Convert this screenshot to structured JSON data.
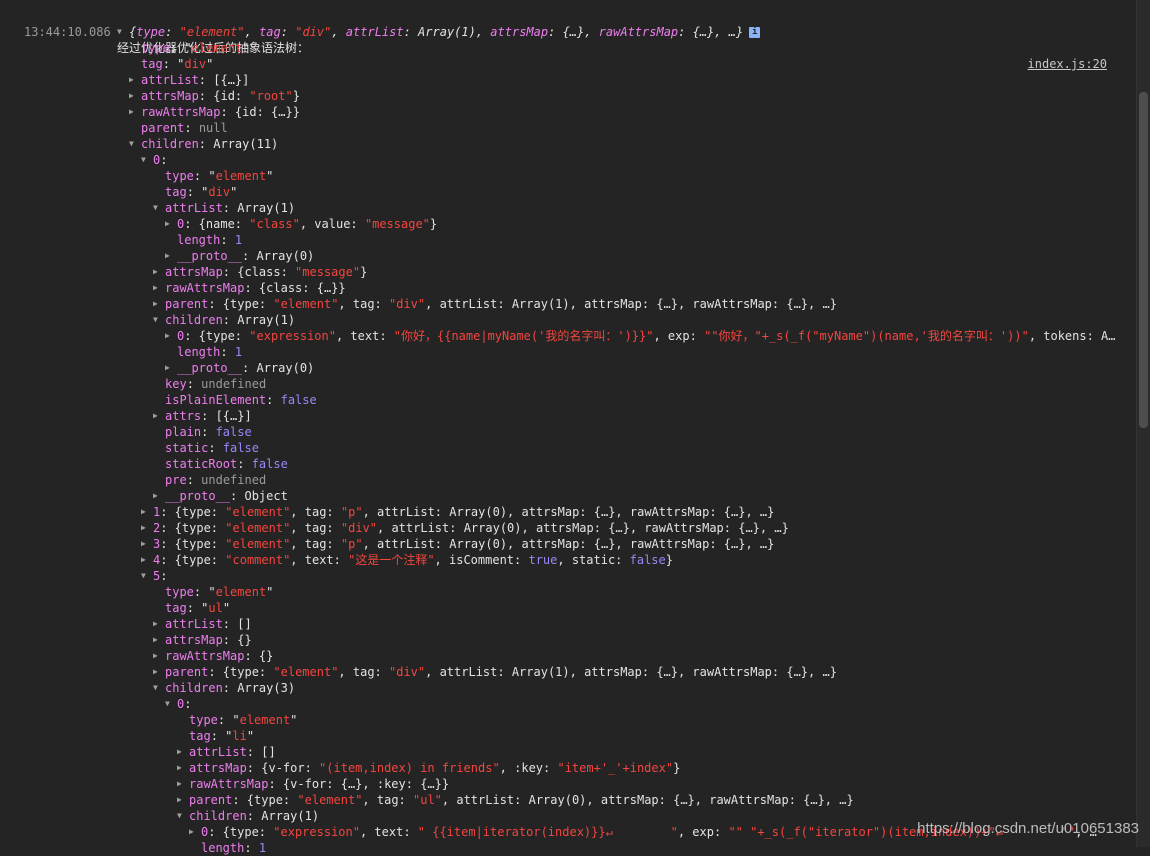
{
  "console": {
    "timestamp": "13:44:10.086",
    "message": "经过优化器优化过后的抽象语法树：",
    "source_link": "index.js:20",
    "info_badge": "i",
    "lines": [
      {
        "indent": 0,
        "tri": "down",
        "tokens": [
          [
            "p",
            "{"
          ],
          [
            "k",
            "type"
          ],
          [
            "p",
            ": "
          ],
          [
            "s",
            "\"element\""
          ],
          [
            "p",
            ", "
          ],
          [
            "k",
            "tag"
          ],
          [
            "p",
            ": "
          ],
          [
            "s",
            "\"div\""
          ],
          [
            "p",
            ", "
          ],
          [
            "k",
            "attrList"
          ],
          [
            "p",
            ": Array(1), "
          ],
          [
            "k",
            "attrsMap"
          ],
          [
            "p",
            ": {…}, "
          ],
          [
            "k",
            "rawAttrsMap"
          ],
          [
            "p",
            ": {…}, …}"
          ]
        ]
      },
      {
        "indent": 1,
        "tri": "",
        "tokens": [
          [
            "k",
            "type"
          ],
          [
            "p",
            ": \""
          ],
          [
            "s",
            "element"
          ],
          [
            "p",
            "\""
          ]
        ]
      },
      {
        "indent": 1,
        "tri": "",
        "tokens": [
          [
            "k",
            "tag"
          ],
          [
            "p",
            ": \""
          ],
          [
            "s",
            "div"
          ],
          [
            "p",
            "\""
          ]
        ]
      },
      {
        "indent": 1,
        "tri": "right",
        "tokens": [
          [
            "k",
            "attrList"
          ],
          [
            "p",
            ": [{…}]"
          ]
        ]
      },
      {
        "indent": 1,
        "tri": "right",
        "tokens": [
          [
            "k",
            "attrsMap"
          ],
          [
            "p",
            ": {id: "
          ],
          [
            "s",
            "\"root\""
          ],
          [
            "p",
            "}"
          ]
        ]
      },
      {
        "indent": 1,
        "tri": "right",
        "tokens": [
          [
            "k",
            "rawAttrsMap"
          ],
          [
            "p",
            ": {id: {…}}"
          ]
        ]
      },
      {
        "indent": 1,
        "tri": "",
        "tokens": [
          [
            "k",
            "parent"
          ],
          [
            "p",
            ": "
          ],
          [
            "g",
            "null"
          ]
        ]
      },
      {
        "indent": 1,
        "tri": "down",
        "tokens": [
          [
            "k",
            "children"
          ],
          [
            "p",
            ": Array(11)"
          ]
        ]
      },
      {
        "indent": 2,
        "tri": "down",
        "tokens": [
          [
            "k",
            "0"
          ],
          [
            "p",
            ":"
          ]
        ]
      },
      {
        "indent": 3,
        "tri": "",
        "tokens": [
          [
            "k",
            "type"
          ],
          [
            "p",
            ": \""
          ],
          [
            "s",
            "element"
          ],
          [
            "p",
            "\""
          ]
        ]
      },
      {
        "indent": 3,
        "tri": "",
        "tokens": [
          [
            "k",
            "tag"
          ],
          [
            "p",
            ": \""
          ],
          [
            "s",
            "div"
          ],
          [
            "p",
            "\""
          ]
        ]
      },
      {
        "indent": 3,
        "tri": "down",
        "tokens": [
          [
            "k",
            "attrList"
          ],
          [
            "p",
            ": Array(1)"
          ]
        ]
      },
      {
        "indent": 4,
        "tri": "right",
        "tokens": [
          [
            "k",
            "0"
          ],
          [
            "p",
            ": {name: "
          ],
          [
            "s",
            "\"class\""
          ],
          [
            "p",
            ", value: "
          ],
          [
            "s",
            "\"message\""
          ],
          [
            "p",
            "}"
          ]
        ]
      },
      {
        "indent": 4,
        "tri": "",
        "tokens": [
          [
            "k",
            "length"
          ],
          [
            "p",
            ": "
          ],
          [
            "n",
            "1"
          ]
        ]
      },
      {
        "indent": 4,
        "tri": "right",
        "tokens": [
          [
            "k",
            "__proto__"
          ],
          [
            "p",
            ": Array(0)"
          ]
        ]
      },
      {
        "indent": 3,
        "tri": "right",
        "tokens": [
          [
            "k",
            "attrsMap"
          ],
          [
            "p",
            ": {class: "
          ],
          [
            "s",
            "\"message\""
          ],
          [
            "p",
            "}"
          ]
        ]
      },
      {
        "indent": 3,
        "tri": "right",
        "tokens": [
          [
            "k",
            "rawAttrsMap"
          ],
          [
            "p",
            ": {class: {…}}"
          ]
        ]
      },
      {
        "indent": 3,
        "tri": "right",
        "tokens": [
          [
            "k",
            "parent"
          ],
          [
            "p",
            ": {type: "
          ],
          [
            "s",
            "\"element\""
          ],
          [
            "p",
            ", tag: "
          ],
          [
            "s",
            "\"div\""
          ],
          [
            "p",
            ", attrList: Array(1), attrsMap: {…}, rawAttrsMap: {…}, …}"
          ]
        ]
      },
      {
        "indent": 3,
        "tri": "down",
        "tokens": [
          [
            "k",
            "children"
          ],
          [
            "p",
            ": Array(1)"
          ]
        ]
      },
      {
        "indent": 4,
        "tri": "right",
        "tokens": [
          [
            "k",
            "0"
          ],
          [
            "p",
            ": {type: "
          ],
          [
            "s",
            "\"expression\""
          ],
          [
            "p",
            ", text: "
          ],
          [
            "s",
            "\"你好，{{name|myName('我的名字叫：')}}\""
          ],
          [
            "p",
            ", exp: "
          ],
          [
            "s",
            "\"\"你好，\"+_s(_f(\"myName\")(name,'我的名字叫：'))\""
          ],
          [
            "p",
            ", tokens: A…"
          ]
        ]
      },
      {
        "indent": 4,
        "tri": "",
        "tokens": [
          [
            "k",
            "length"
          ],
          [
            "p",
            ": "
          ],
          [
            "n",
            "1"
          ]
        ]
      },
      {
        "indent": 4,
        "tri": "right",
        "tokens": [
          [
            "k",
            "__proto__"
          ],
          [
            "p",
            ": Array(0)"
          ]
        ]
      },
      {
        "indent": 3,
        "tri": "",
        "tokens": [
          [
            "k",
            "key"
          ],
          [
            "p",
            ": "
          ],
          [
            "g",
            "undefined"
          ]
        ]
      },
      {
        "indent": 3,
        "tri": "",
        "tokens": [
          [
            "k",
            "isPlainElement"
          ],
          [
            "p",
            ": "
          ],
          [
            "n",
            "false"
          ]
        ]
      },
      {
        "indent": 3,
        "tri": "right",
        "tokens": [
          [
            "k",
            "attrs"
          ],
          [
            "p",
            ": [{…}]"
          ]
        ]
      },
      {
        "indent": 3,
        "tri": "",
        "tokens": [
          [
            "k",
            "plain"
          ],
          [
            "p",
            ": "
          ],
          [
            "n",
            "false"
          ]
        ]
      },
      {
        "indent": 3,
        "tri": "",
        "tokens": [
          [
            "k",
            "static"
          ],
          [
            "p",
            ": "
          ],
          [
            "n",
            "false"
          ]
        ]
      },
      {
        "indent": 3,
        "tri": "",
        "tokens": [
          [
            "k",
            "staticRoot"
          ],
          [
            "p",
            ": "
          ],
          [
            "n",
            "false"
          ]
        ]
      },
      {
        "indent": 3,
        "tri": "",
        "tokens": [
          [
            "k",
            "pre"
          ],
          [
            "p",
            ": "
          ],
          [
            "g",
            "undefined"
          ]
        ]
      },
      {
        "indent": 3,
        "tri": "right",
        "tokens": [
          [
            "k",
            "__proto__"
          ],
          [
            "p",
            ": Object"
          ]
        ]
      },
      {
        "indent": 2,
        "tri": "right",
        "tokens": [
          [
            "k",
            "1"
          ],
          [
            "p",
            ": {type: "
          ],
          [
            "s",
            "\"element\""
          ],
          [
            "p",
            ", tag: "
          ],
          [
            "s",
            "\"p\""
          ],
          [
            "p",
            ", attrList: Array(0), attrsMap: {…}, rawAttrsMap: {…}, …}"
          ]
        ]
      },
      {
        "indent": 2,
        "tri": "right",
        "tokens": [
          [
            "k",
            "2"
          ],
          [
            "p",
            ": {type: "
          ],
          [
            "s",
            "\"element\""
          ],
          [
            "p",
            ", tag: "
          ],
          [
            "s",
            "\"div\""
          ],
          [
            "p",
            ", attrList: Array(0), attrsMap: {…}, rawAttrsMap: {…}, …}"
          ]
        ]
      },
      {
        "indent": 2,
        "tri": "right",
        "tokens": [
          [
            "k",
            "3"
          ],
          [
            "p",
            ": {type: "
          ],
          [
            "s",
            "\"element\""
          ],
          [
            "p",
            ", tag: "
          ],
          [
            "s",
            "\"p\""
          ],
          [
            "p",
            ", attrList: Array(0), attrsMap: {…}, rawAttrsMap: {…}, …}"
          ]
        ]
      },
      {
        "indent": 2,
        "tri": "right",
        "tokens": [
          [
            "k",
            "4"
          ],
          [
            "p",
            ": {type: "
          ],
          [
            "s",
            "\"comment\""
          ],
          [
            "p",
            ", text: "
          ],
          [
            "s",
            "\"这是一个注释\""
          ],
          [
            "p",
            ", isComment: "
          ],
          [
            "n",
            "true"
          ],
          [
            "p",
            ", static: "
          ],
          [
            "n",
            "false"
          ],
          [
            "p",
            "}"
          ]
        ]
      },
      {
        "indent": 2,
        "tri": "down",
        "tokens": [
          [
            "k",
            "5"
          ],
          [
            "p",
            ":"
          ]
        ]
      },
      {
        "indent": 3,
        "tri": "",
        "tokens": [
          [
            "k",
            "type"
          ],
          [
            "p",
            ": \""
          ],
          [
            "s",
            "element"
          ],
          [
            "p",
            "\""
          ]
        ]
      },
      {
        "indent": 3,
        "tri": "",
        "tokens": [
          [
            "k",
            "tag"
          ],
          [
            "p",
            ": \""
          ],
          [
            "s",
            "ul"
          ],
          [
            "p",
            "\""
          ]
        ]
      },
      {
        "indent": 3,
        "tri": "right",
        "tokens": [
          [
            "k",
            "attrList"
          ],
          [
            "p",
            ": []"
          ]
        ]
      },
      {
        "indent": 3,
        "tri": "right",
        "tokens": [
          [
            "k",
            "attrsMap"
          ],
          [
            "p",
            ": {}"
          ]
        ]
      },
      {
        "indent": 3,
        "tri": "right",
        "tokens": [
          [
            "k",
            "rawAttrsMap"
          ],
          [
            "p",
            ": {}"
          ]
        ]
      },
      {
        "indent": 3,
        "tri": "right",
        "tokens": [
          [
            "k",
            "parent"
          ],
          [
            "p",
            ": {type: "
          ],
          [
            "s",
            "\"element\""
          ],
          [
            "p",
            ", tag: "
          ],
          [
            "s",
            "\"div\""
          ],
          [
            "p",
            ", attrList: Array(1), attrsMap: {…}, rawAttrsMap: {…}, …}"
          ]
        ]
      },
      {
        "indent": 3,
        "tri": "down",
        "tokens": [
          [
            "k",
            "children"
          ],
          [
            "p",
            ": Array(3)"
          ]
        ]
      },
      {
        "indent": 4,
        "tri": "down",
        "tokens": [
          [
            "k",
            "0"
          ],
          [
            "p",
            ":"
          ]
        ]
      },
      {
        "indent": 5,
        "tri": "",
        "tokens": [
          [
            "k",
            "type"
          ],
          [
            "p",
            ": \""
          ],
          [
            "s",
            "element"
          ],
          [
            "p",
            "\""
          ]
        ]
      },
      {
        "indent": 5,
        "tri": "",
        "tokens": [
          [
            "k",
            "tag"
          ],
          [
            "p",
            ": \""
          ],
          [
            "s",
            "li"
          ],
          [
            "p",
            "\""
          ]
        ]
      },
      {
        "indent": 5,
        "tri": "right",
        "tokens": [
          [
            "k",
            "attrList"
          ],
          [
            "p",
            ": []"
          ]
        ]
      },
      {
        "indent": 5,
        "tri": "right",
        "tokens": [
          [
            "k",
            "attrsMap"
          ],
          [
            "p",
            ": {v-for: "
          ],
          [
            "s",
            "\"(item,index) in friends\""
          ],
          [
            "p",
            ", :key: "
          ],
          [
            "s",
            "\"item+'_'+index\""
          ],
          [
            "p",
            "}"
          ]
        ]
      },
      {
        "indent": 5,
        "tri": "right",
        "tokens": [
          [
            "k",
            "rawAttrsMap"
          ],
          [
            "p",
            ": {v-for: {…}, :key: {…}}"
          ]
        ]
      },
      {
        "indent": 5,
        "tri": "right",
        "tokens": [
          [
            "k",
            "parent"
          ],
          [
            "p",
            ": {type: "
          ],
          [
            "s",
            "\"element\""
          ],
          [
            "p",
            ", tag: "
          ],
          [
            "s",
            "\"ul\""
          ],
          [
            "p",
            ", attrList: Array(0), attrsMap: {…}, rawAttrsMap: {…}, …}"
          ]
        ]
      },
      {
        "indent": 5,
        "tri": "down",
        "tokens": [
          [
            "k",
            "children"
          ],
          [
            "p",
            ": Array(1)"
          ]
        ]
      },
      {
        "indent": 6,
        "tri": "right",
        "tokens": [
          [
            "k",
            "0"
          ],
          [
            "p",
            ": {type: "
          ],
          [
            "s",
            "\"expression\""
          ],
          [
            "p",
            ", text: "
          ],
          [
            "s",
            "\" {{item|iterator(index)}}↵        \""
          ],
          [
            "p",
            ", exp: "
          ],
          [
            "s",
            "\"\" \"+_s(_f(\"iterator\")(item,index))+\"↵        \"\""
          ],
          [
            "p",
            ", …"
          ]
        ]
      },
      {
        "indent": 6,
        "tri": "",
        "tokens": [
          [
            "k",
            "length"
          ],
          [
            "p",
            ": "
          ],
          [
            "n",
            "1"
          ]
        ]
      }
    ]
  },
  "watermark": "https://blog.csdn.net/u010651383"
}
